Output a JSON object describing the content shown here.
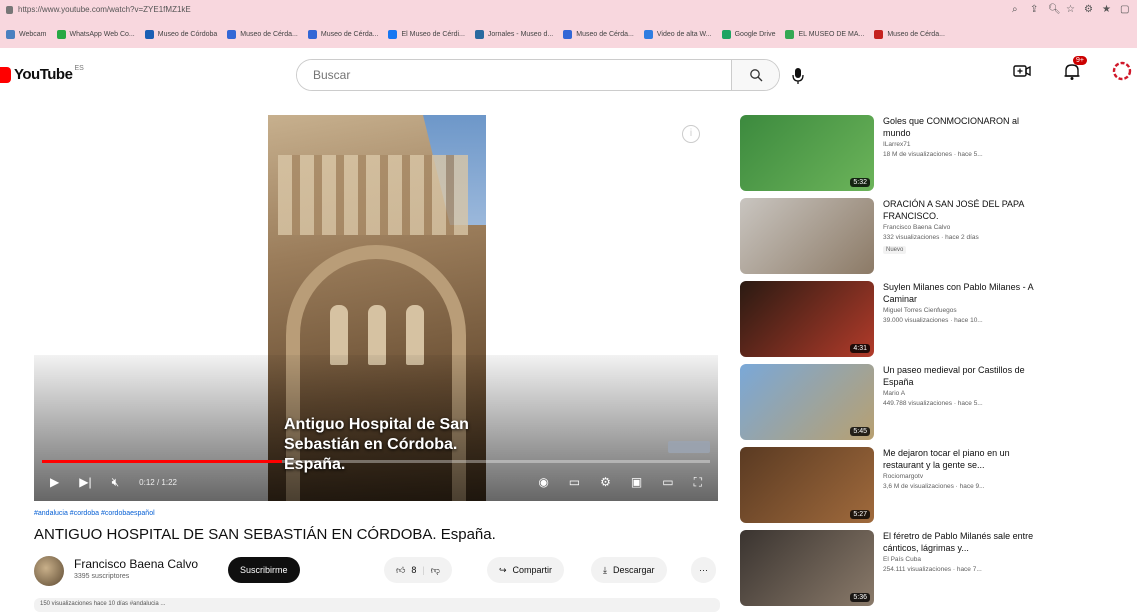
{
  "browser": {
    "url": "https://www.youtube.com/watch?v=ZYE1fMZ1kE",
    "bookmarks": [
      "Webcam",
      "WhatsApp Web Co...",
      "Museo de Córdoba",
      "Museo de Cérda...",
      "Museo de Cérda...",
      "El Museo de Cérdi...",
      "Jornales - Museo d...",
      "Museo de Cérda...",
      "Video de alta W...",
      "Google Drive",
      "EL MUSEO DE MA...",
      "Museo de Cérda..."
    ]
  },
  "header": {
    "logo_text": "YouTube",
    "country": "ES",
    "search_placeholder": "Buscar",
    "notif_count": "9+"
  },
  "video": {
    "overlay_title": "Antiguo Hospital de San Sebastián en Córdoba. España.",
    "time": "0:12 / 1:22",
    "progress": 0.36,
    "hashtags": "#andalucia #cordoba #cordobaespañol",
    "title": "ANTIGUO HOSPITAL DE SAN SEBASTIÁN EN CÓRDOBA. España.",
    "channel": "Francisco Baena Calvo",
    "subscribers": "3395 suscriptores",
    "subscribe_label": "Suscribirme",
    "like_count": "8",
    "share_label": "Compartir",
    "download_label": "Descargar",
    "more_label": "···",
    "description_preview": "150 visualizaciones  hace 10 días  #andalucia ..."
  },
  "recommendations": [
    {
      "title": "Goles que CONMOCIONARON al mundo",
      "channel": "ILarrex71",
      "meta": "18 M de visualizaciones · hace 5...",
      "duration": "5:32",
      "thumb_colors": [
        "#3c8a3e",
        "#6cb45a"
      ],
      "tag": ""
    },
    {
      "title": "ORACIÓN A SAN JOSÉ DEL PAPA FRANCISCO.",
      "channel": "Francisco Baena Calvo",
      "meta": "332 visualizaciones · hace 2 días",
      "duration": "",
      "thumb_colors": [
        "#c9c5c0",
        "#8c7a66"
      ],
      "tag": "Nuevo"
    },
    {
      "title": "Suylen Milanes con Pablo Milanes - A Caminar",
      "channel": "Miguel Torres Cienfuegos",
      "meta": "39.000 visualizaciones · hace 10...",
      "duration": "4:31",
      "thumb_colors": [
        "#2a1a12",
        "#b23b2a"
      ],
      "tag": ""
    },
    {
      "title": "Un paseo medieval por Castillos de España",
      "channel": "Mario A",
      "meta": "449.788 visualizaciones · hace 5...",
      "duration": "5:45",
      "thumb_colors": [
        "#7aa8d8",
        "#b8a070"
      ],
      "tag": ""
    },
    {
      "title": "Me dejaron tocar el piano en un restaurant y la gente se...",
      "channel": "Rociomargotv",
      "meta": "3,6 M de visualizaciones · hace 9...",
      "duration": "5:27",
      "thumb_colors": [
        "#5a3a22",
        "#a06a3c"
      ],
      "tag": ""
    },
    {
      "title": "El féretro de Pablo Milanés sale entre cánticos, lágrimas y...",
      "channel": "El País Cuba",
      "meta": "254.111 visualizaciones · hace 7...",
      "duration": "5:36",
      "thumb_colors": [
        "#3a3430",
        "#8a7a6a"
      ],
      "tag": ""
    }
  ]
}
